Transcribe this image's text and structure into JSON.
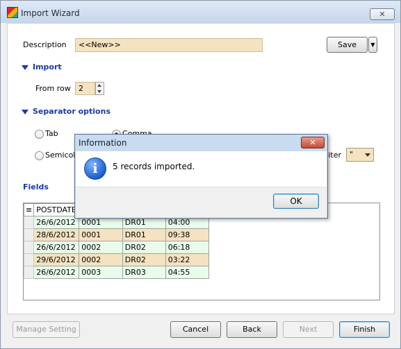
{
  "window": {
    "title": "Import Wizard",
    "close_glyph": "✕"
  },
  "description": {
    "label": "Description",
    "value": "<<New>>"
  },
  "save": {
    "label": "Save",
    "dropdown_glyph": "▼"
  },
  "import_section": {
    "title": "Import",
    "from_row_label": "From row",
    "from_row_value": "2"
  },
  "separator_section": {
    "title": "Separator options",
    "tab_label": "Tab",
    "comma_label": "Comma",
    "semicolon_label": "Semicolon",
    "delimiter_label": "Text delimiter",
    "delimiter_value": "\""
  },
  "fields": {
    "title": "Fields",
    "column_header": "POSTDATE",
    "rows": [
      [
        "26/6/2012",
        "0001",
        "DR01",
        "04:00"
      ],
      [
        "28/6/2012",
        "0001",
        "DR01",
        "09:38"
      ],
      [
        "26/6/2012",
        "0002",
        "DR02",
        "06:18"
      ],
      [
        "29/6/2012",
        "0002",
        "DR02",
        "03:22"
      ],
      [
        "26/6/2012",
        "0003",
        "DR03",
        "04:55"
      ]
    ]
  },
  "footer": {
    "manage": "Manage Setting",
    "cancel": "Cancel",
    "back": "Back",
    "next": "Next",
    "finish": "Finish"
  },
  "dialog": {
    "title": "Information",
    "close_glyph": "✕",
    "icon": "info-icon",
    "message": "5 records imported.",
    "ok": "OK"
  },
  "colors": {
    "accent": "#1b3aa8",
    "field_tan": "#f4e2c1",
    "row_green": "#e9fbea"
  }
}
